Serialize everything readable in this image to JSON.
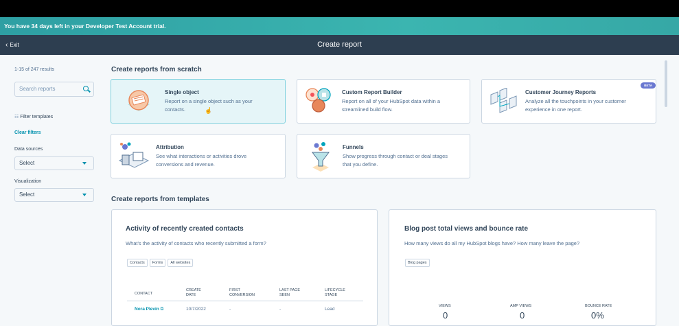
{
  "trial_banner": "You have 34 days left in your Developer Test Account trial.",
  "header": {
    "exit_label": "Exit",
    "title": "Create report"
  },
  "sidebar": {
    "results": "1-15 of 247 results",
    "search_placeholder": "Search reports",
    "filter_templates": "Filter templates",
    "clear_filters": "Clear filters",
    "data_sources_label": "Data sources",
    "data_sources_value": "Select",
    "visualization_label": "Visualization",
    "visualization_value": "Select"
  },
  "scratch": {
    "heading": "Create reports from scratch",
    "cards": [
      {
        "title": "Single object",
        "desc1": "Report on a single object such as your",
        "desc2": "contacts."
      },
      {
        "title": "Custom Report Builder",
        "desc1": "Report on all of your HubSpot data within a",
        "desc2": "streamlined build flow."
      },
      {
        "title": "Customer Journey Reports",
        "desc1": "Analyze all the touchpoints in your customer",
        "desc2": "experience in one report.",
        "badge": "BETA"
      },
      {
        "title": "Attribution",
        "desc1": "See what interactions or activities drove",
        "desc2": "conversions and revenue."
      },
      {
        "title": "Funnels",
        "desc1": "Show progress through contact or deal stages",
        "desc2": "that you define."
      }
    ]
  },
  "templates": {
    "heading": "Create reports from templates",
    "left": {
      "title": "Activity of recently created contacts",
      "desc": "What's the activity of contacts who recently submitted a form?",
      "tags": [
        "Contacts",
        "Forms",
        "All websites"
      ],
      "columns": [
        "CONTACT",
        "CREATE DATE",
        "FIRST CONVERSION",
        "LAST PAGE SEEN",
        "LIFECYCLE STAGE"
      ],
      "col_lines": [
        [
          "CONTACT",
          ""
        ],
        [
          "CREATE",
          "DATE"
        ],
        [
          "FIRST",
          "CONVERSION"
        ],
        [
          "LAST PAGE",
          "SEEN"
        ],
        [
          "LIFECYCLE",
          "STAGE"
        ]
      ],
      "row": [
        "Nora Plevin",
        "10/7/2022",
        "-",
        "-",
        "Lead"
      ]
    },
    "right": {
      "title": "Blog post total views and bounce rate",
      "desc": "How many views do all my HubSpot blogs have? How many leave the page?",
      "tags": [
        "Blog pages"
      ],
      "stats": [
        {
          "label": "VIEWS",
          "value": "0"
        },
        {
          "label": "AMP VIEWS",
          "value": "0"
        },
        {
          "label": "BOUNCE RATE",
          "value": "0%"
        }
      ]
    }
  },
  "colors": {
    "accent": "#0091ae",
    "topbar": "#2d3e50",
    "banner": "#3bb5b0",
    "selected": "#e5f5f8"
  },
  "icons": [
    "chevron-left-icon",
    "search-icon",
    "filter-icon",
    "caret-down-icon",
    "external-link-icon",
    "cursor-icon"
  ]
}
